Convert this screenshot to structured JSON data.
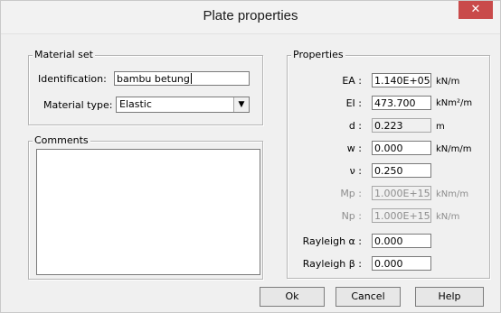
{
  "window": {
    "title": "Plate properties",
    "close_glyph": "✕"
  },
  "material_set": {
    "legend": "Material set",
    "identification_label": "Identification:",
    "identification_value": "bambu betung",
    "material_type_label": "Material type:",
    "material_type_value": "Elastic"
  },
  "comments": {
    "legend": "Comments",
    "value": ""
  },
  "properties": {
    "legend": "Properties",
    "rows": [
      {
        "symbol": "EA :",
        "value": "1.140E+05",
        "unit": "kN/m",
        "enabled": true
      },
      {
        "symbol": "EI :",
        "value": "473.700",
        "unit": "kNm²/m",
        "enabled": true
      },
      {
        "symbol": "d :",
        "value": "0.223",
        "unit": "m",
        "enabled": true
      },
      {
        "symbol": "w :",
        "value": "0.000",
        "unit": "kN/m/m",
        "enabled": true
      },
      {
        "symbol": "ν :",
        "value": "0.250",
        "unit": "",
        "enabled": true
      },
      {
        "symbol": "Mp :",
        "value": "1.000E+15",
        "unit": "kNm/m",
        "enabled": false
      },
      {
        "symbol": "Np :",
        "value": "1.000E+15",
        "unit": "kN/m",
        "enabled": false
      },
      {
        "symbol": "Rayleigh α :",
        "value": "0.000",
        "unit": "",
        "enabled": true
      },
      {
        "symbol": "Rayleigh β :",
        "value": "0.000",
        "unit": "",
        "enabled": true
      }
    ]
  },
  "buttons": {
    "ok": "Ok",
    "cancel": "Cancel",
    "help": "Help"
  },
  "icons": {
    "close": "close-icon",
    "dropdown": "chevron-down-icon"
  }
}
